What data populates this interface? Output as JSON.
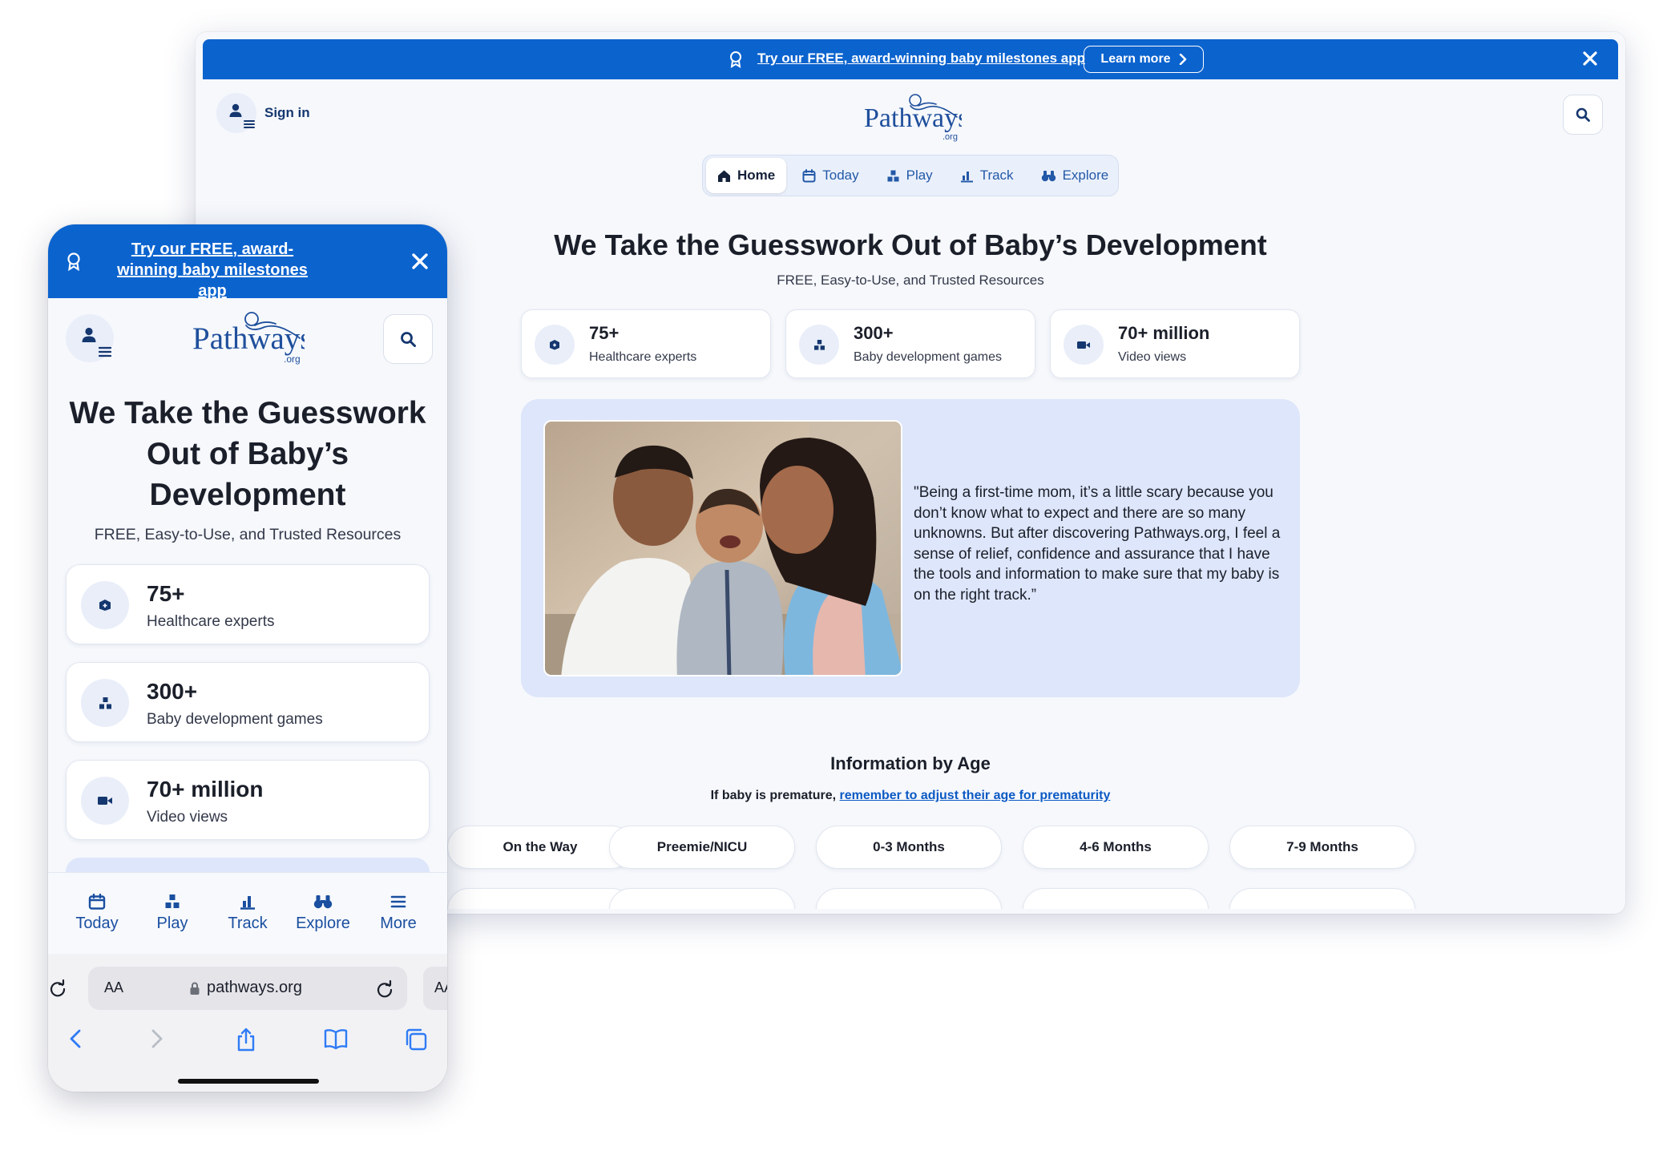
{
  "desktop": {
    "banner": {
      "text": "Try our FREE, award-winning baby milestones app",
      "learn_more": "Learn more"
    },
    "header": {
      "sign_in": "Sign in",
      "logo_text": "Pathways",
      "logo_sub": ".org"
    },
    "nav": [
      {
        "label": "Home",
        "icon": "home-icon",
        "active": true
      },
      {
        "label": "Today",
        "icon": "calendar-icon",
        "active": false
      },
      {
        "label": "Play",
        "icon": "blocks-icon",
        "active": false
      },
      {
        "label": "Track",
        "icon": "chart-icon",
        "active": false
      },
      {
        "label": "Explore",
        "icon": "binoculars-icon",
        "active": false
      }
    ],
    "hero": {
      "title": "We Take the Guesswork Out of Baby’s Development",
      "subtitle": "FREE, Easy-to-Use, and Trusted Resources"
    },
    "stats": [
      {
        "value": "75+",
        "label": "Healthcare experts",
        "icon": "medical-kit-icon"
      },
      {
        "value": "300+",
        "label": "Baby development games",
        "icon": "blocks-icon"
      },
      {
        "value": "70+ million",
        "label": "Video views",
        "icon": "video-camera-icon"
      }
    ],
    "testimonial": {
      "quote": "\"Being a first-time mom, it’s a little scary because you don’t know what to expect and there are so many unknowns. But after discovering Pathways.org, I feel a sense of relief, confidence and assurance that I have the tools and information to make sure that my baby is on the right track.”"
    },
    "info_by_age": {
      "title": "Information by Age",
      "note_prefix": "If baby is premature, ",
      "note_link": "remember to adjust their age for prematurity",
      "ages": [
        "On the Way",
        "Preemie/NICU",
        "0-3 Months",
        "4-6 Months",
        "7-9 Months"
      ]
    }
  },
  "phone": {
    "banner": {
      "text": "Try our FREE, award-winning baby milestones app"
    },
    "logo_text": "Pathways",
    "logo_sub": ".org",
    "hero": {
      "title": "We Take the Guesswork Out of Baby’s Development",
      "subtitle": "FREE, Easy-to-Use, and Trusted Resources"
    },
    "stats": [
      {
        "value": "75+",
        "label": "Healthcare experts",
        "icon": "medical-kit-icon"
      },
      {
        "value": "300+",
        "label": "Baby development games",
        "icon": "blocks-icon"
      },
      {
        "value": "70+ million",
        "label": "Video views",
        "icon": "video-camera-icon"
      }
    ],
    "tabbar": [
      {
        "label": "Today",
        "icon": "calendar-icon"
      },
      {
        "label": "Play",
        "icon": "blocks-icon"
      },
      {
        "label": "Track",
        "icon": "chart-icon"
      },
      {
        "label": "Explore",
        "icon": "binoculars-icon"
      },
      {
        "label": "More",
        "icon": "menu-icon"
      }
    ],
    "safari": {
      "aa": "AA",
      "url": "pathways.org"
    }
  },
  "colors": {
    "brand_blue": "#0b63ce",
    "navy": "#15376f",
    "link": "#0b59c4",
    "card_tint": "#dde6fa",
    "page_bg": "#f6f8fc"
  }
}
